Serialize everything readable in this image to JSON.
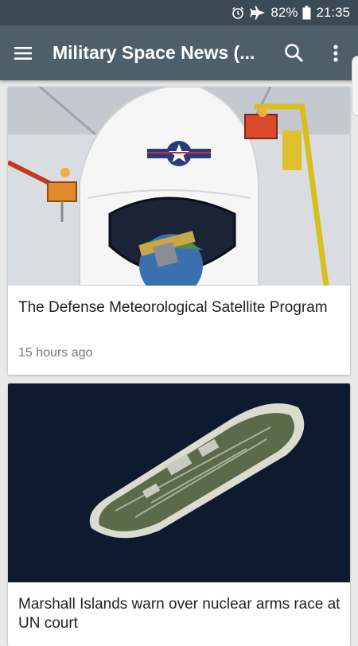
{
  "status_bar": {
    "battery": "82%",
    "time": "21:35",
    "icons": [
      "alarm-icon",
      "airplane-icon",
      "battery-icon"
    ]
  },
  "toolbar": {
    "title": "Military Space News (...",
    "icons": [
      "menu-icon",
      "search-icon",
      "more-vert-icon"
    ]
  },
  "colors": {
    "status_bar": "#3b4a53",
    "toolbar": "#4e5f69",
    "background": "#e9e9e9",
    "card": "#ffffff"
  },
  "feed": {
    "articles": [
      {
        "headline": "The Defense Meteorological Satellite Program",
        "time": "15 hours ago"
      },
      {
        "headline": "Marshall Islands warn over nuclear arms race at UN court",
        "time": ""
      }
    ]
  }
}
